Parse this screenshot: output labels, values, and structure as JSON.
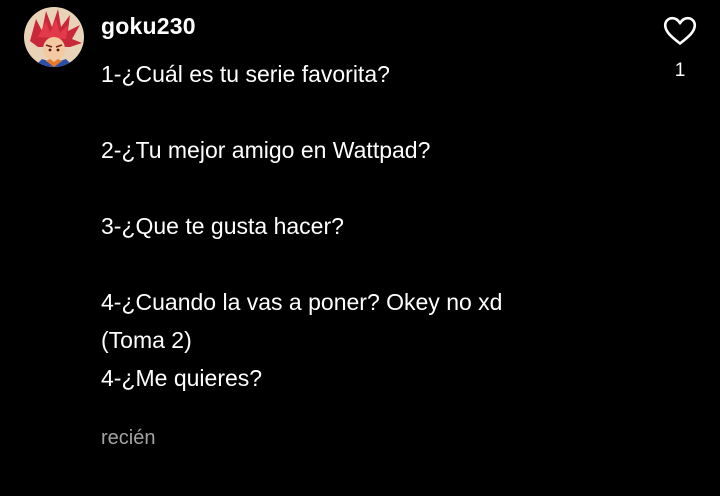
{
  "comment": {
    "author": "goku230",
    "body_lines": [
      "1-¿Cuál es tu serie favorita?",
      "",
      "2-¿Tu mejor amigo en Wattpad?",
      "",
      "3-¿Que te gusta hacer?",
      "",
      "4-¿Cuando la vas a poner? Okey no xd",
      "(Toma 2)",
      "4-¿Me quieres?"
    ],
    "timestamp": "recién",
    "likes": "1",
    "like_icon": "heart-outline-icon"
  },
  "colors": {
    "background": "#000000",
    "text": "#ffffff",
    "muted_text": "#a3a3a3",
    "avatar_hair": "#c8283a",
    "avatar_bg": "#e9d3b8"
  }
}
